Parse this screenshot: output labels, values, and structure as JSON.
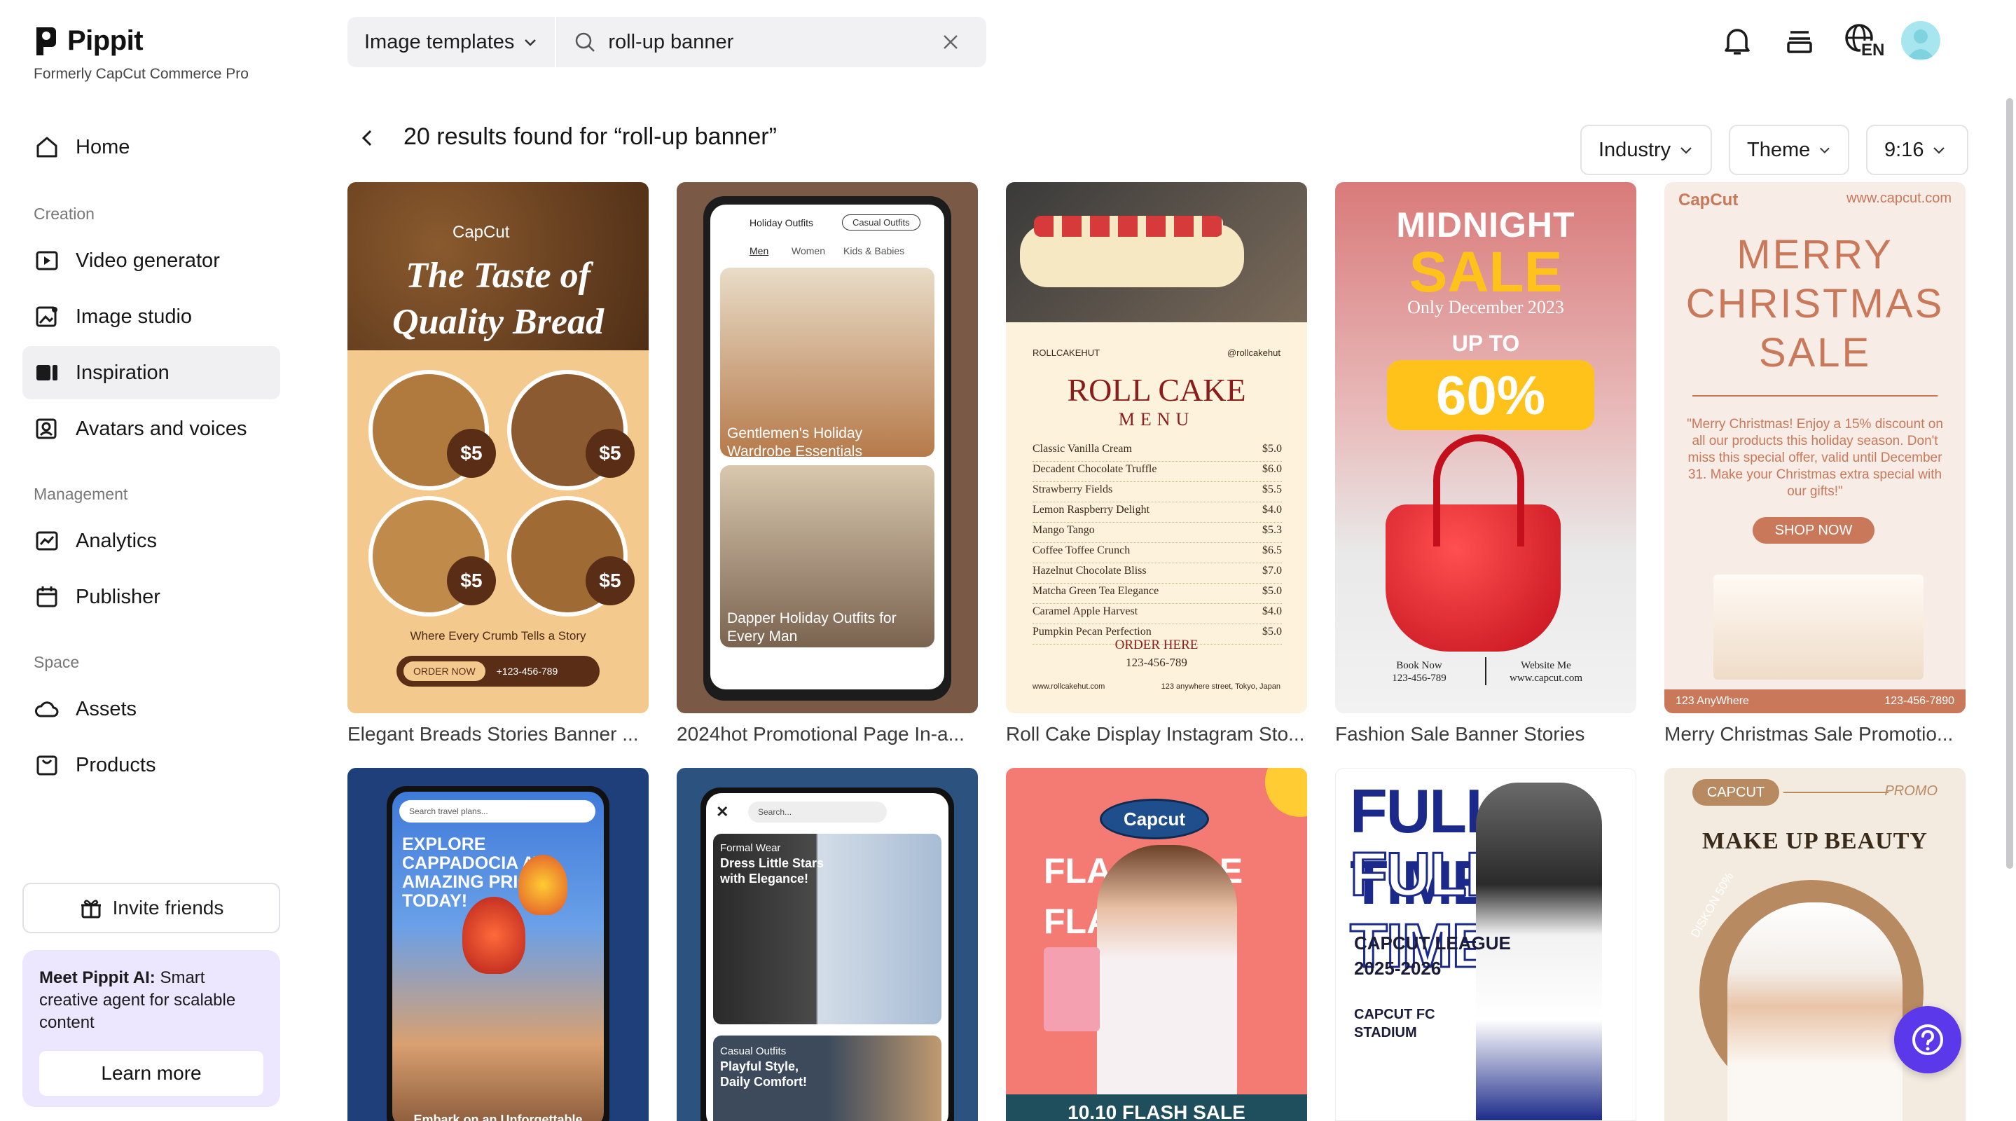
{
  "brand": {
    "name": "Pippit",
    "subtitle": "Formerly CapCut Commerce Pro"
  },
  "sidebar": {
    "home": "Home",
    "section_creation": "Creation",
    "video_generator": "Video generator",
    "image_studio": "Image studio",
    "inspiration": "Inspiration",
    "avatars_voices": "Avatars and voices",
    "section_management": "Management",
    "analytics": "Analytics",
    "publisher": "Publisher",
    "section_space": "Space",
    "assets": "Assets",
    "products": "Products",
    "invite": "Invite friends",
    "promo_bold": "Meet Pippit AI:",
    "promo_rest": " Smart creative agent for scalable content",
    "learn_more": "Learn more"
  },
  "search": {
    "type": "Image templates",
    "query": "roll-up banner"
  },
  "topbar": {
    "language": "EN"
  },
  "results": {
    "title": "20 results found for “roll-up banner”",
    "filters": {
      "industry": "Industry",
      "theme": "Theme",
      "ratio": "9:16"
    }
  },
  "cards_row1": [
    "Elegant Breads Stories Banner ...",
    "2024hot Promotional Page In-a...",
    "Roll Cake Display Instagram Sto...",
    "Fashion Sale Banner Stories",
    "Merry Christmas Sale Promotio..."
  ],
  "thumb1": {
    "brand": "CapCut",
    "title1": "The Taste of",
    "title2": "Quality Bread",
    "price": "$5",
    "tag": "Where Every Crumb Tells a Story",
    "order": "ORDER NOW",
    "phone": "+123-456-789"
  },
  "thumb2": {
    "tab1": "Holiday Outfits",
    "tab2": "Casual Outfits",
    "nav1": "Men",
    "nav2": "Women",
    "nav3": "Kids & Babies",
    "cap1": "Gentlemen's Holiday Wardrobe Essentials",
    "cap2": "Dapper Holiday Outfits for Every Man"
  },
  "thumb3": {
    "brand": "ROLLCAKEHUT",
    "handle": "@rollcakehut",
    "title": "ROLL CAKE",
    "sub": "MENU",
    "items": [
      [
        "Classic Vanilla Cream",
        "$5.0"
      ],
      [
        "Decadent Chocolate Truffle",
        "$6.0"
      ],
      [
        "Strawberry Fields",
        "$5.5"
      ],
      [
        "Lemon Raspberry Delight",
        "$4.0"
      ],
      [
        "Mango Tango",
        "$5.3"
      ],
      [
        "Coffee Toffee Crunch",
        "$6.5"
      ],
      [
        "Hazelnut Chocolate Bliss",
        "$7.0"
      ],
      [
        "Matcha Green Tea Elegance",
        "$5.0"
      ],
      [
        "Caramel Apple Harvest",
        "$4.0"
      ],
      [
        "Pumpkin Pecan Perfection",
        "$5.0"
      ]
    ],
    "order": "ORDER HERE",
    "phone": "123-456-789",
    "site": "www.rollcakehut.com",
    "address": "123 anywhere street, Tokyo, Japan"
  },
  "thumb4": {
    "title1": "MIDNIGHT",
    "title2": "SALE",
    "date": "Only December 2023",
    "upto": "UP TO",
    "pct": "60%",
    "book": "Book Now",
    "book_phone": "123-456-789",
    "web": "Website Me",
    "web_url": "www.capcut.com"
  },
  "thumb5": {
    "brand": "CapCut",
    "site": "www.capcut.com",
    "l1": "MERRY",
    "l2": "CHRISTMAS",
    "l3": "SALE",
    "body": "\"Merry Christmas! Enjoy a 15% discount on all our products this holiday season. Don't miss this special offer, valid until December 31. Make your Christmas extra special with our gifts!\"",
    "cta": "SHOP NOW",
    "addr": "123 AnyWhere",
    "phone": "123-456-7890"
  },
  "thumb6": {
    "search": "Search travel plans...",
    "t1": "EXPLORE",
    "t2": "CAPPADOCIA AT",
    "t3": "AMAZING PRICES",
    "t4": "TODAY!",
    "bottom": "Embark on an Unforgettable"
  },
  "thumb7": {
    "search": "Search...",
    "k1": "Formal Wear",
    "h1a": "Dress Little Stars",
    "h1b": "with Elegance!",
    "k2": "Casual Outfits",
    "h2a": "Playful Style,",
    "h2b": "Daily Comfort!"
  },
  "thumb8": {
    "brand": "Capcut",
    "l1": "FLA    SALE",
    "l2": "FLA",
    "bottom": "10.10 FLASH SALE"
  },
  "thumb9": {
    "big1": "FULL TIME",
    "big2": "FULL TIME",
    "league": "CAPCUT LEAGUE",
    "season": "2025-2026",
    "stadium1": "CAPCUT FC",
    "stadium2": "STADIUM"
  },
  "thumb10": {
    "brand": "CAPCUT",
    "promo": "PROMO",
    "title": "MAKE UP BEAUTY",
    "badge": "DISKON 50%"
  },
  "colors": {
    "accent": "#5b39ea",
    "active_bg": "#f0f0f2",
    "promo_bg": "#ece6ff"
  }
}
